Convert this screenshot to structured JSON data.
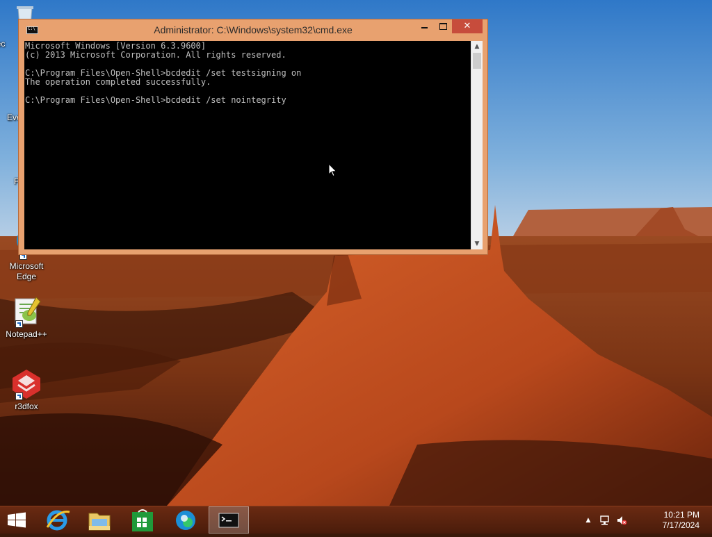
{
  "desktop": {
    "icons": [
      {
        "label": "Rec",
        "icon": "recycle-bin-icon"
      },
      {
        "label": "Eve",
        "icon": "app-shortcut-icon"
      },
      {
        "label": "F",
        "icon": "firefox-icon"
      },
      {
        "label": "Microsoft Edge",
        "icon": "edge-icon"
      },
      {
        "label": "Notepad++",
        "icon": "notepadpp-icon"
      },
      {
        "label": "r3dfox",
        "icon": "r3dfox-icon"
      }
    ]
  },
  "window": {
    "title": "Administrator: C:\\Windows\\system32\\cmd.exe",
    "close_glyph": "✕",
    "console_lines": [
      "Microsoft Windows [Version 6.3.9600]",
      "(c) 2013 Microsoft Corporation. All rights reserved.",
      "",
      "C:\\Program Files\\Open-Shell>bcdedit /set testsigning on",
      "The operation completed successfully.",
      "",
      "C:\\Program Files\\Open-Shell>bcdedit /set nointegrity"
    ],
    "colors": {
      "frame": "#e8a16f",
      "close": "#c74c3c",
      "console_bg": "#000000",
      "console_fg": "#c0c0c0"
    }
  },
  "taskbar": {
    "buttons": [
      {
        "icon": "windows-start-icon"
      },
      {
        "icon": "internet-explorer-icon"
      },
      {
        "icon": "file-explorer-icon"
      },
      {
        "icon": "store-icon"
      },
      {
        "icon": "edge-icon"
      },
      {
        "icon": "cmd-icon",
        "active": true
      }
    ],
    "tray": {
      "up_glyph": "▲",
      "network_icon": "network-icon",
      "volume_icon": "volume-muted-icon"
    },
    "clock": {
      "time": "10:21 PM",
      "date": "7/17/2024"
    }
  }
}
